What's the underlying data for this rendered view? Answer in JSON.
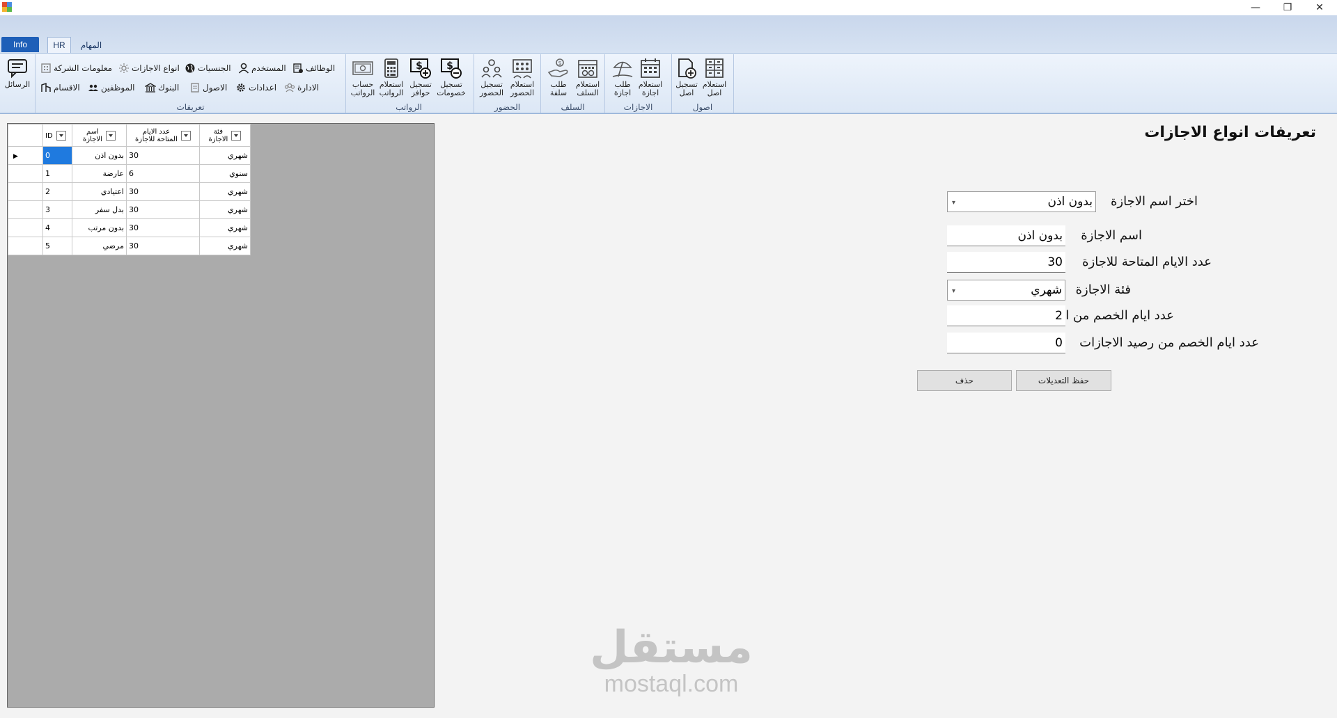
{
  "window": {
    "minimize": "—",
    "restore": "❐",
    "close": "✕"
  },
  "tabs": {
    "info": "Info",
    "hr": "HR",
    "tasks": "المهام"
  },
  "ribbon": {
    "messages": "الرسائل",
    "groups": {
      "definitions": "تعريفات",
      "salaries": "الرواتب",
      "attendance": "الحضور",
      "advances": "السلف",
      "leaves": "الاجازات",
      "assets": "اصول"
    },
    "small": {
      "company_info": "معلومات الشركة",
      "leave_types": "انواع الاجازات",
      "nationalities": "الجنسيات",
      "user": "المستخدم",
      "jobs": "الوظائف",
      "departments": "الاقسام",
      "employees": "الموظفين",
      "banks": "البنوك",
      "assets": "الاصول",
      "settings": "اعدادات",
      "administration": "الادارة"
    },
    "big": {
      "calc_salaries": [
        "حساب",
        "الرواتب"
      ],
      "query_salaries": [
        "استعلام",
        "الرواتب"
      ],
      "register_incentives": [
        "تسجيل",
        "حوافز"
      ],
      "register_deductions": [
        "تسجيل",
        "خصومات"
      ],
      "register_attendance": [
        "تسجيل",
        "الحضور"
      ],
      "query_attendance": [
        "استعلام",
        "الحضور"
      ],
      "request_advance": [
        "طلب",
        "سلفة"
      ],
      "query_advances": [
        "استعلام",
        "السلف"
      ],
      "request_leave": [
        "طلب",
        "اجازة"
      ],
      "query_leave": [
        "استعلام",
        "اجازة"
      ],
      "register_asset": [
        "تسجيل",
        "اصل"
      ],
      "query_asset": [
        "استعلام",
        "اصل"
      ]
    }
  },
  "grid": {
    "headers": {
      "id": "ID",
      "name": [
        "اسم",
        "الاجازة"
      ],
      "days": [
        "عدد الايام",
        "المتاحة للاجازة"
      ],
      "category": [
        "فئة",
        "الاجازة"
      ]
    },
    "rows": [
      {
        "id": "0",
        "name": "بدون اذن",
        "days": "30",
        "category": "شهري"
      },
      {
        "id": "1",
        "name": "عارضة",
        "days": "6",
        "category": "سنوي"
      },
      {
        "id": "2",
        "name": "اعتيادي",
        "days": "30",
        "category": "شهري"
      },
      {
        "id": "3",
        "name": "بدل سفر",
        "days": "30",
        "category": "شهري"
      },
      {
        "id": "4",
        "name": "بدون مرتب",
        "days": "30",
        "category": "شهري"
      },
      {
        "id": "5",
        "name": "مرضي",
        "days": "30",
        "category": "شهري"
      }
    ]
  },
  "form": {
    "title": "تعريفات انواع الاجازات",
    "select_leave_label": "اختر اسم الاجازة",
    "select_leave_value": "بدون اذن",
    "leave_name_label": "اسم الاجازة",
    "leave_name_value": "بدون اذن",
    "available_days_label": "عدد الايام المتاحة للاجازة",
    "available_days_value": "30",
    "category_label": "فئة الاجازة",
    "category_value": "شهري",
    "salary_deduction_label": "عدد ايام الخصم من المرتب",
    "salary_deduction_value": "2",
    "balance_deduction_label": "عدد ايام الخصم من رصيد الاجازات",
    "balance_deduction_value": "0",
    "save_button": "حفظ التعديلات",
    "delete_button": "حذف"
  },
  "watermark": {
    "arabic": "مستقل",
    "latin": "mostaql.com"
  }
}
